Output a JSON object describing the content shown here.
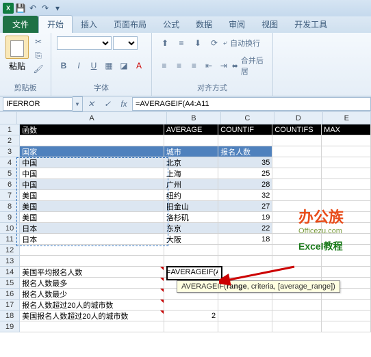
{
  "qat": {
    "save": "💾",
    "undo": "↶",
    "redo": "↷"
  },
  "tabs": {
    "file": "文件",
    "home": "开始",
    "insert": "插入",
    "layout": "页面布局",
    "formula": "公式",
    "data": "数据",
    "review": "审阅",
    "view": "视图",
    "dev": "开发工具"
  },
  "ribbon": {
    "clipboard": {
      "paste": "粘贴",
      "label": "剪贴板"
    },
    "font": {
      "label": "字体",
      "bold": "B",
      "italic": "I",
      "underline": "U"
    },
    "align": {
      "label": "对齐方式",
      "wrap": "自动换行",
      "merge": "合并后居"
    }
  },
  "formula_bar": {
    "name": "IFERROR",
    "fx": "fx",
    "value": "=AVERAGEIF(A4:A11"
  },
  "cols": [
    "A",
    "B",
    "C",
    "D",
    "E"
  ],
  "rows": [
    {
      "n": 1,
      "c": [
        {
          "v": "函数",
          "cls": "hdr-dark"
        },
        {
          "v": "AVERAGE",
          "cls": "hdr-dark"
        },
        {
          "v": "COUNTIF",
          "cls": "hdr-dark"
        },
        {
          "v": "COUNTIFS",
          "cls": "hdr-dark"
        },
        {
          "v": "MAX",
          "cls": "hdr-dark"
        }
      ]
    },
    {
      "n": 2,
      "c": [
        {
          "v": ""
        },
        {
          "v": ""
        },
        {
          "v": ""
        },
        {
          "v": ""
        },
        {
          "v": ""
        }
      ]
    },
    {
      "n": 3,
      "c": [
        {
          "v": "国家",
          "cls": "hdr-blue"
        },
        {
          "v": "城市",
          "cls": "hdr-blue"
        },
        {
          "v": "报名人数",
          "cls": "hdr-blue"
        },
        {
          "v": ""
        },
        {
          "v": ""
        }
      ]
    },
    {
      "n": 4,
      "c": [
        {
          "v": "中国",
          "cls": "lt-blue"
        },
        {
          "v": "北京",
          "cls": "lt-blue"
        },
        {
          "v": "35",
          "cls": "lt-blue num"
        },
        {
          "v": ""
        },
        {
          "v": ""
        }
      ]
    },
    {
      "n": 5,
      "c": [
        {
          "v": "中国"
        },
        {
          "v": "上海"
        },
        {
          "v": "25",
          "cls": "num"
        },
        {
          "v": ""
        },
        {
          "v": ""
        }
      ]
    },
    {
      "n": 6,
      "c": [
        {
          "v": "中国",
          "cls": "lt-blue"
        },
        {
          "v": "广州",
          "cls": "lt-blue"
        },
        {
          "v": "28",
          "cls": "lt-blue num"
        },
        {
          "v": ""
        },
        {
          "v": ""
        }
      ]
    },
    {
      "n": 7,
      "c": [
        {
          "v": "美国"
        },
        {
          "v": "纽约"
        },
        {
          "v": "32",
          "cls": "num"
        },
        {
          "v": ""
        },
        {
          "v": ""
        }
      ]
    },
    {
      "n": 8,
      "c": [
        {
          "v": "美国",
          "cls": "lt-blue"
        },
        {
          "v": "旧金山",
          "cls": "lt-blue"
        },
        {
          "v": "27",
          "cls": "lt-blue num"
        },
        {
          "v": ""
        },
        {
          "v": ""
        }
      ]
    },
    {
      "n": 9,
      "c": [
        {
          "v": "美国"
        },
        {
          "v": "洛杉矶"
        },
        {
          "v": "19",
          "cls": "num"
        },
        {
          "v": ""
        },
        {
          "v": ""
        }
      ]
    },
    {
      "n": 10,
      "c": [
        {
          "v": "日本",
          "cls": "lt-blue"
        },
        {
          "v": "东京",
          "cls": "lt-blue"
        },
        {
          "v": "22",
          "cls": "lt-blue num"
        },
        {
          "v": ""
        },
        {
          "v": ""
        }
      ]
    },
    {
      "n": 11,
      "c": [
        {
          "v": "日本"
        },
        {
          "v": "大阪"
        },
        {
          "v": "18",
          "cls": "num"
        },
        {
          "v": ""
        },
        {
          "v": ""
        }
      ]
    },
    {
      "n": 12,
      "c": [
        {
          "v": ""
        },
        {
          "v": ""
        },
        {
          "v": ""
        },
        {
          "v": ""
        },
        {
          "v": ""
        }
      ]
    },
    {
      "n": 13,
      "c": [
        {
          "v": ""
        },
        {
          "v": ""
        },
        {
          "v": ""
        },
        {
          "v": ""
        },
        {
          "v": ""
        }
      ]
    },
    {
      "n": 14,
      "c": [
        {
          "v": "美国平均报名人数",
          "cls": "redmark"
        },
        {
          "v": "=AVERAGEIF(A4:A11"
        },
        {
          "v": ""
        },
        {
          "v": ""
        },
        {
          "v": ""
        }
      ]
    },
    {
      "n": 15,
      "c": [
        {
          "v": "报名人数最多",
          "cls": "redmark"
        },
        {
          "v": ""
        },
        {
          "v": ""
        },
        {
          "v": ""
        },
        {
          "v": ""
        }
      ]
    },
    {
      "n": 16,
      "c": [
        {
          "v": "报名人数最少",
          "cls": "redmark"
        },
        {
          "v": ""
        },
        {
          "v": ""
        },
        {
          "v": ""
        },
        {
          "v": ""
        }
      ]
    },
    {
      "n": 17,
      "c": [
        {
          "v": "报名人数超过20人的城市数",
          "cls": "redmark"
        },
        {
          "v": ""
        },
        {
          "v": ""
        },
        {
          "v": ""
        },
        {
          "v": ""
        }
      ]
    },
    {
      "n": 18,
      "c": [
        {
          "v": "美国报名人数超过20人的城市数",
          "cls": "redmark"
        },
        {
          "v": "2",
          "cls": "num"
        },
        {
          "v": ""
        },
        {
          "v": ""
        },
        {
          "v": ""
        }
      ]
    },
    {
      "n": 19,
      "c": [
        {
          "v": ""
        },
        {
          "v": ""
        },
        {
          "v": ""
        },
        {
          "v": ""
        },
        {
          "v": ""
        }
      ]
    }
  ],
  "tooltip": {
    "fn": "AVERAGEIF",
    "sig": "(range, criteria, [average_range])",
    "bold": "range"
  },
  "watermark": {
    "l1": "办公族",
    "l2": "Officezu.com",
    "l3": "Excel教程"
  }
}
